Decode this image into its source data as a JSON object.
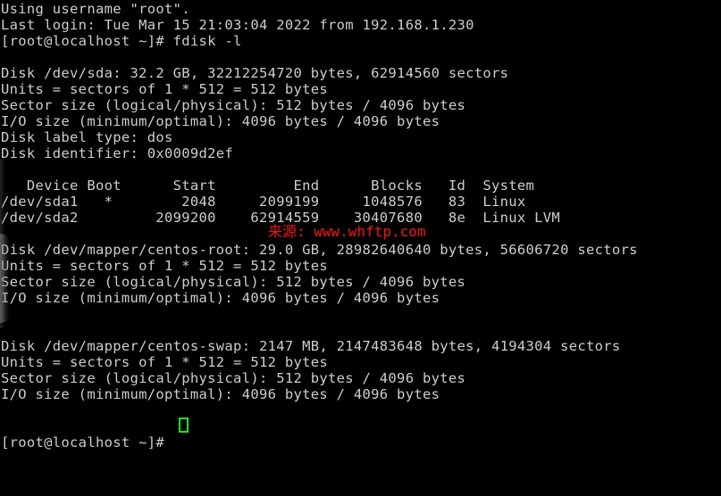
{
  "terminal": {
    "shell_prompt": "[root@localhost ~]#",
    "command": "fdisk -l",
    "background_color": "#000000",
    "text_color": "#cdcdcd",
    "cursor_color": "#19e619",
    "watermark_color": "#d31c1c"
  },
  "session": {
    "using_username_line": "Using username \"root\".",
    "last_login_line": "Last login: Tue Mar 15 21:03:04 2022 from 192.168.1.230",
    "username": "root",
    "last_login_day": "Tue",
    "last_login_month": "Mar",
    "last_login_date": "15",
    "last_login_time": "21:03:04",
    "last_login_year": "2022",
    "last_login_from_ip": "192.168.1.230"
  },
  "lines": [
    "Using username \"root\".",
    "Last login: Tue Mar 15 21:03:04 2022 from 192.168.1.230",
    "[root@localhost ~]# fdisk -l",
    "",
    "Disk /dev/sda: 32.2 GB, 32212254720 bytes, 62914560 sectors",
    "Units = sectors of 1 * 512 = 512 bytes",
    "Sector size (logical/physical): 512 bytes / 4096 bytes",
    "I/O size (minimum/optimal): 4096 bytes / 4096 bytes",
    "Disk label type: dos",
    "Disk identifier: 0x0009d2ef",
    "",
    "   Device Boot      Start         End      Blocks   Id  System",
    "/dev/sda1   *        2048     2099199     1048576   83  Linux",
    "/dev/sda2         2099200    62914559    30407680   8e  Linux LVM",
    "",
    "Disk /dev/mapper/centos-root: 29.0 GB, 28982640640 bytes, 56606720 sectors",
    "Units = sectors of 1 * 512 = 512 bytes",
    "Sector size (logical/physical): 512 bytes / 4096 bytes",
    "I/O size (minimum/optimal): 4096 bytes / 4096 bytes",
    "",
    "",
    "Disk /dev/mapper/centos-swap: 2147 MB, 2147483648 bytes, 4194304 sectors",
    "Units = sectors of 1 * 512 = 512 bytes",
    "Sector size (logical/physical): 512 bytes / 4096 bytes",
    "I/O size (minimum/optimal): 4096 bytes / 4096 bytes",
    "",
    "",
    "[root@localhost ~]# "
  ],
  "disks": [
    {
      "device": "/dev/sda",
      "size_human": "32.2 GB",
      "size_bytes": "32212254720",
      "sectors": "62914560",
      "units": "sectors of 1 * 512 = 512 bytes",
      "sector_size_logical": "512 bytes",
      "sector_size_physical": "4096 bytes",
      "io_size_minimum": "4096 bytes",
      "io_size_optimal": "4096 bytes",
      "disk_label_type": "dos",
      "disk_identifier": "0x0009d2ef"
    },
    {
      "device": "/dev/mapper/centos-root",
      "size_human": "29.0 GB",
      "size_bytes": "28982640640",
      "sectors": "56606720",
      "units": "sectors of 1 * 512 = 512 bytes",
      "sector_size_logical": "512 bytes",
      "sector_size_physical": "4096 bytes",
      "io_size_minimum": "4096 bytes",
      "io_size_optimal": "4096 bytes"
    },
    {
      "device": "/dev/mapper/centos-swap",
      "size_human": "2147 MB",
      "size_bytes": "2147483648",
      "sectors": "4194304",
      "units": "sectors of 1 * 512 = 512 bytes",
      "sector_size_logical": "512 bytes",
      "sector_size_physical": "4096 bytes",
      "io_size_minimum": "4096 bytes",
      "io_size_optimal": "4096 bytes"
    }
  ],
  "partition_table": {
    "headers": [
      "Device",
      "Boot",
      "Start",
      "End",
      "Blocks",
      "Id",
      "System"
    ],
    "rows": [
      {
        "device": "/dev/sda1",
        "boot": "*",
        "start": "2048",
        "end": "2099199",
        "blocks": "1048576",
        "id": "83",
        "system": "Linux"
      },
      {
        "device": "/dev/sda2",
        "boot": "",
        "start": "2099200",
        "end": "62914559",
        "blocks": "30407680",
        "id": "8e",
        "system": "Linux LVM"
      }
    ]
  },
  "watermark": {
    "text": "来源: www.whftp.com",
    "source_label": "来源:",
    "url": "www.whftp.com"
  }
}
